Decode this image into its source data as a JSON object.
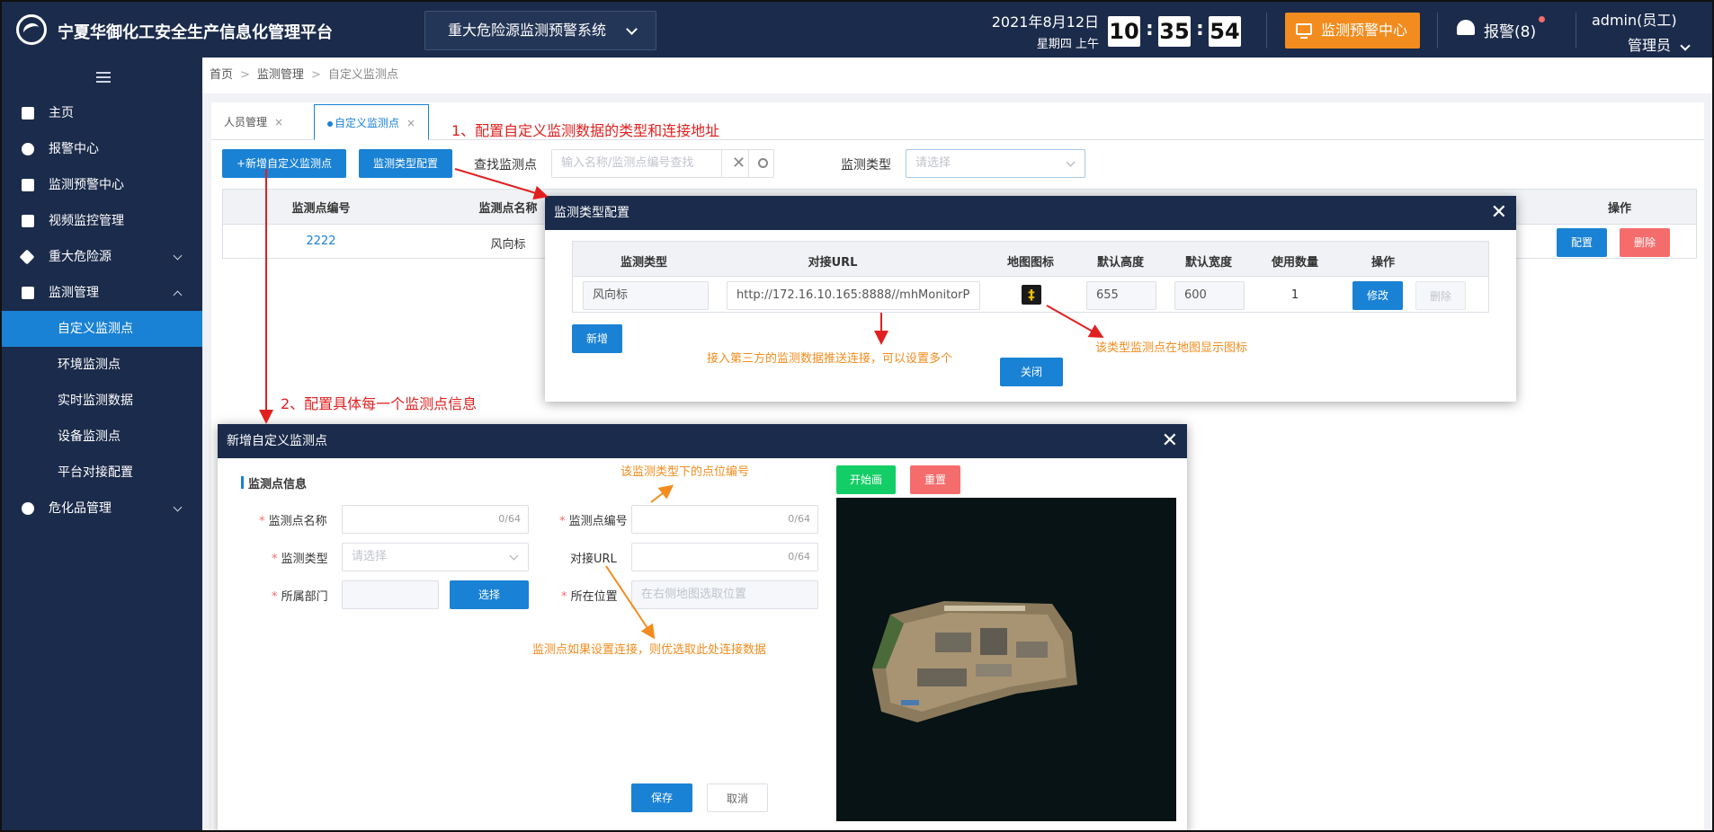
{
  "header": {
    "app_title": "宁夏华御化工安全生产信息化管理平台",
    "system_select": "重大危险源监测预警系统",
    "date": "2021年8月12日",
    "weekday": "星期四  上午",
    "clock": {
      "hh": "10",
      "mm": "35",
      "ss": "54"
    },
    "monitor_center": "监测预警中心",
    "alarm_label": "报警(8)",
    "user_name": "admin(员工)",
    "user_role": "管理员"
  },
  "sidebar": {
    "items": [
      {
        "label": "主页"
      },
      {
        "label": "报警中心"
      },
      {
        "label": "监测预警中心"
      },
      {
        "label": "视频监控管理"
      },
      {
        "label": "重大危险源"
      },
      {
        "label": "监测管理"
      },
      {
        "label": "危化品管理"
      }
    ],
    "sub_items": [
      {
        "label": "自定义监测点"
      },
      {
        "label": "环境监测点"
      },
      {
        "label": "实时监测数据"
      },
      {
        "label": "设备监测点"
      },
      {
        "label": "平台对接配置"
      }
    ]
  },
  "breadcrumb": {
    "home": "首页",
    "parent": "监测管理",
    "current": "自定义监测点"
  },
  "tabs": [
    {
      "label": "人员管理"
    },
    {
      "label": "自定义监测点"
    }
  ],
  "toolbar": {
    "add_button": "+新增自定义监测点",
    "type_config_button": "监测类型配置",
    "search_label": "查找监测点",
    "search_placeholder": "输入名称/监测点编号查找",
    "type_label": "监测类型",
    "type_placeholder": "请选择"
  },
  "table": {
    "headers": {
      "code": "监测点编号",
      "name": "监测点名称",
      "ops": "操作"
    },
    "rows": [
      {
        "code": "2222",
        "name": "风向标",
        "config": "配置",
        "delete": "删除"
      }
    ]
  },
  "type_modal": {
    "title": "监测类型配置",
    "headers": [
      "监测类型",
      "对接URL",
      "地图图标",
      "默认高度",
      "默认宽度",
      "使用数量",
      "操作"
    ],
    "row": {
      "type": "风向标",
      "url": "http://172.16.10.165:8888//mhMonitorP",
      "height": "655",
      "width": "600",
      "count": "1",
      "edit": "修改",
      "delete": "删除"
    },
    "add_button": "新增",
    "close_button": "关闭"
  },
  "add_modal": {
    "title": "新增自定义监测点",
    "section": "监测点信息",
    "fields": {
      "name_label": "监测点名称",
      "name_count": "0/64",
      "code_label": "监测点编号",
      "code_count": "0/64",
      "type_label": "监测类型",
      "type_placeholder": "请选择",
      "url_label": "对接URL",
      "url_count": "0/64",
      "dept_label": "所属部门",
      "select_button": "选择",
      "location_label": "所在位置",
      "location_placeholder": "在右侧地图选取位置"
    },
    "draw_button": "开始画",
    "reset_button": "重置",
    "save_button": "保存",
    "cancel_button": "取消"
  },
  "annotations": {
    "step1": "1、配置自定义监测数据的类型和连接地址",
    "step2": "2、配置具体每一个监测点信息",
    "url_note": "接入第三方的监测数据推送连接，可以设置多个",
    "icon_note": "该类型监测点在地图显示图标",
    "code_note": "该监测类型下的点位编号",
    "priority_note": "监测点如果设置连接，则优选取此处连接数据"
  },
  "colors": {
    "nav_bg": "#1b2b4b",
    "primary": "#1a82d4",
    "orange": "#f28c1e",
    "danger": "#f56c6c",
    "success": "#13ce66",
    "annotation_red": "#e02020"
  }
}
